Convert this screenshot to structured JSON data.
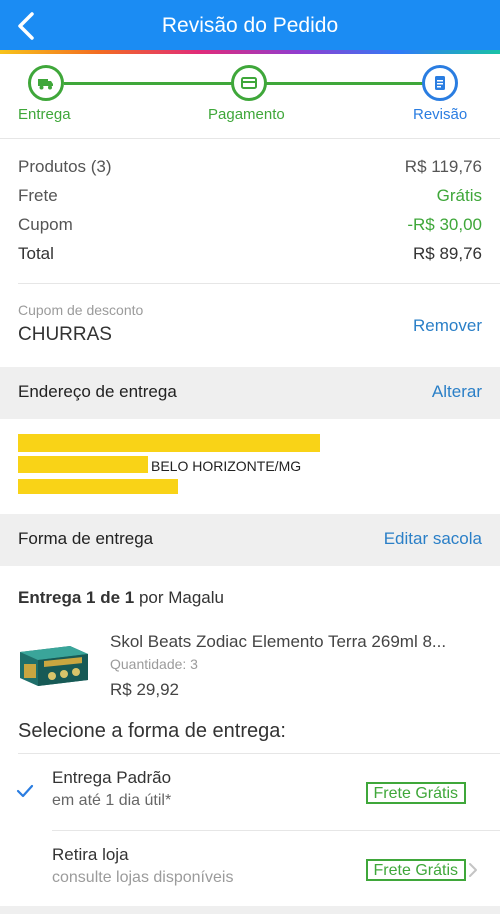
{
  "header": {
    "title": "Revisão do Pedido",
    "back_icon": "back-arrow-icon"
  },
  "stepper": {
    "steps": [
      {
        "label": "Entrega",
        "icon": "truck-icon",
        "state": "done"
      },
      {
        "label": "Pagamento",
        "icon": "card-icon",
        "state": "done"
      },
      {
        "label": "Revisão",
        "icon": "document-icon",
        "state": "current"
      }
    ],
    "done_color": "#3fa73a",
    "current_color": "#2a7de1"
  },
  "summary": {
    "products": {
      "label": "Produtos (3)",
      "value": "R$ 119,76"
    },
    "shipping": {
      "label": "Frete",
      "value": "Grátis"
    },
    "coupon": {
      "label": "Cupom",
      "value": "-R$ 30,00"
    },
    "total": {
      "label": "Total",
      "value": "R$ 89,76"
    }
  },
  "coupon": {
    "label": "Cupom de desconto",
    "code": "CHURRAS",
    "remove_label": "Remover"
  },
  "address": {
    "section_label": "Endereço de entrega",
    "change_label": "Alterar",
    "city": "BELO HORIZONTE/MG"
  },
  "delivery": {
    "section_label": "Forma de entrega",
    "edit_label": "Editar sacola",
    "title_strong": "Entrega 1 de 1",
    "title_rest": " por Magalu",
    "product": {
      "name": "Skol Beats Zodiac Elemento Terra 269ml 8...",
      "quantity": "Quantidade: 3",
      "price": "R$ 29,92"
    },
    "select_title": "Selecione a forma de entrega:",
    "options": [
      {
        "title": "Entrega Padrão",
        "subtitle": "em até 1 dia útil*",
        "badge": "Frete Grátis",
        "selected": true
      },
      {
        "title": "Retira loja",
        "subtitle": "consulte lojas disponíveis",
        "badge": "Frete Grátis",
        "selected": false
      }
    ]
  },
  "colors": {
    "header": "#1b8cf3",
    "green": "#3fa73a",
    "link": "#2a7fc7"
  }
}
